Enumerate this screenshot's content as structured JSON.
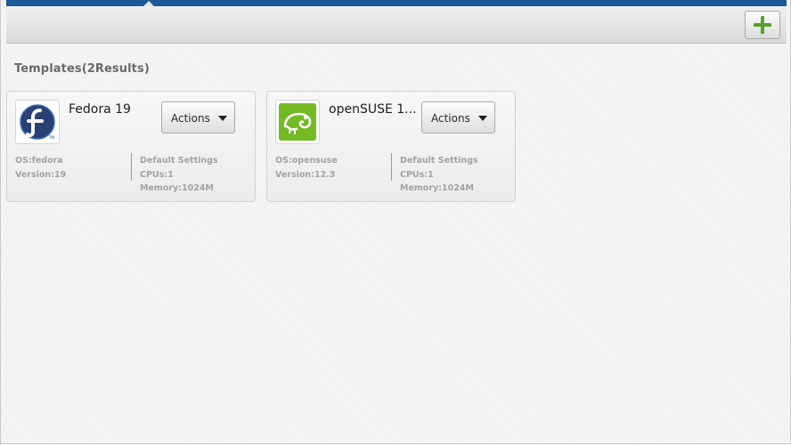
{
  "toolbar": {
    "add_icon": "plus-icon",
    "add_color": "#5aa02c"
  },
  "section": {
    "title": "Templates(2Results)"
  },
  "templates": [
    {
      "name": "Fedora 19",
      "logo": "fedora-logo",
      "actions_label": "Actions",
      "os": "OS:fedora",
      "version": "Version:19",
      "settings_heading": "Default Settings",
      "cpus": "CPUs:1",
      "memory": "Memory:1024M"
    },
    {
      "name": "openSUSE 1...",
      "logo": "opensuse-logo",
      "actions_label": "Actions",
      "os": "OS:opensuse",
      "version": "Version:12.3",
      "settings_heading": "Default Settings",
      "cpus": "CPUs:1",
      "memory": "Memory:1024M"
    }
  ],
  "colors": {
    "header_blue": "#1a5a96",
    "fedora_blue": "#294172",
    "opensuse_green": "#73ba25"
  }
}
